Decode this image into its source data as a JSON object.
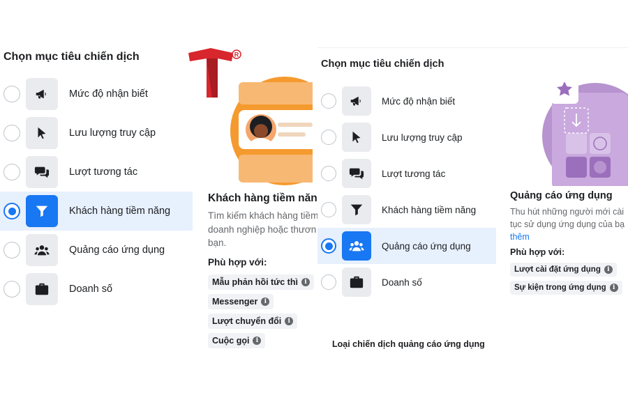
{
  "left_panel": {
    "title": "Chọn mục tiêu chiến dịch",
    "options": [
      {
        "label": "Mức độ nhận biết",
        "icon": "megaphone-icon",
        "selected": false
      },
      {
        "label": "Lưu lượng truy cập",
        "icon": "cursor-icon",
        "selected": false
      },
      {
        "label": "Lượt tương tác",
        "icon": "chat-bubbles-icon",
        "selected": false
      },
      {
        "label": "Khách hàng tiềm năng",
        "icon": "funnel-icon",
        "selected": true
      },
      {
        "label": "Quảng cáo ứng dụng",
        "icon": "people-icon",
        "selected": false
      },
      {
        "label": "Doanh số",
        "icon": "briefcase-icon",
        "selected": false
      }
    ],
    "detail": {
      "heading": "Khách hàng tiềm năng",
      "description": "Tìm kiếm khách hàng tiềm\ndoanh nghiệp hoặc thươn\nbạn.",
      "fit_label": "Phù hợp với:",
      "tags": [
        "Mẫu phản hồi tức thì",
        "Messenger",
        "Lượt chuyển đổi",
        "Cuộc gọi"
      ]
    }
  },
  "right_panel": {
    "title": "Chọn mục tiêu chiến dịch",
    "options": [
      {
        "label": "Mức độ nhận biết",
        "icon": "megaphone-icon",
        "selected": false
      },
      {
        "label": "Lưu lượng truy cập",
        "icon": "cursor-icon",
        "selected": false
      },
      {
        "label": "Lượt tương tác",
        "icon": "chat-bubbles-icon",
        "selected": false
      },
      {
        "label": "Khách hàng tiềm năng",
        "icon": "funnel-icon",
        "selected": false
      },
      {
        "label": "Quảng cáo ứng dụng",
        "icon": "people-icon",
        "selected": true
      },
      {
        "label": "Doanh số",
        "icon": "briefcase-icon",
        "selected": false
      }
    ],
    "detail": {
      "heading": "Quảng cáo ứng dụng",
      "description": "Thu hút những người mới cài\ntục sử dụng ứng dụng của bạ",
      "link": "thêm",
      "fit_label": "Phù hợp với:",
      "tags": [
        "Lượt cài đặt ứng dụng",
        "Sự kiện trong ứng dụng"
      ]
    },
    "caption": "Loại chiến dịch quảng cáo ứng dụng"
  },
  "logo": {
    "letter": "T",
    "mark": "®"
  },
  "colors": {
    "accent": "#1877f2",
    "selected_bg": "#e7f0fd",
    "logo_red": "#d8262d",
    "illus_orange": "#f59a2e",
    "illus_purple": "#b793cf"
  }
}
